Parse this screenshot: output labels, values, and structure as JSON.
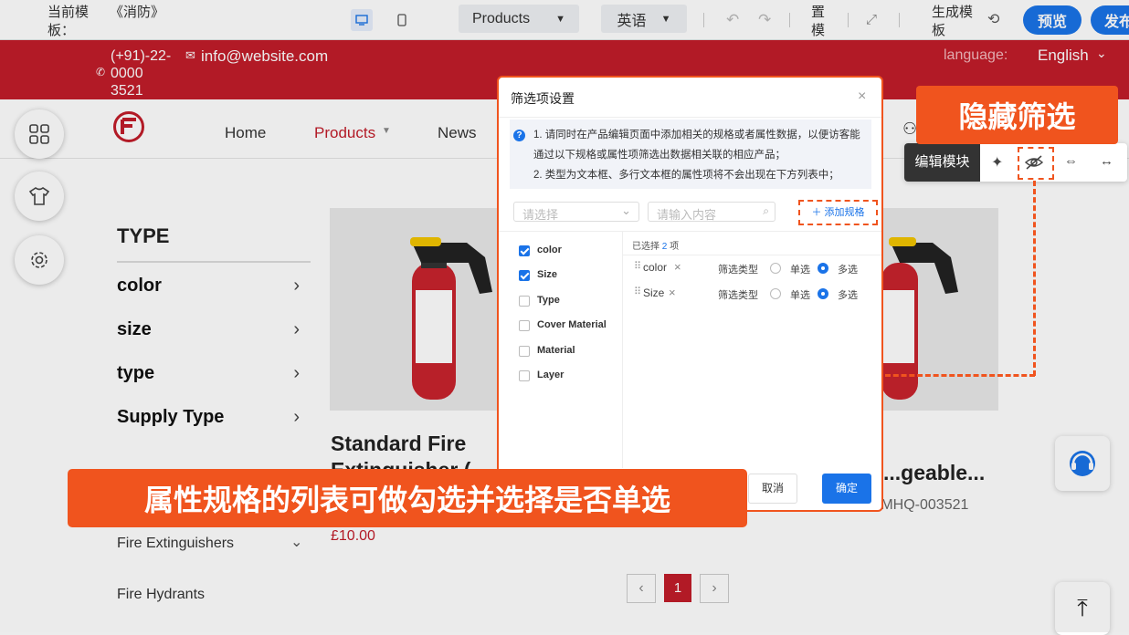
{
  "toolbar": {
    "template_label": "当前模板：",
    "template_name": "《消防》",
    "page_select": "Products",
    "lang_select": "英语",
    "settings_label": "置模",
    "generate_label": "生成模板",
    "preview": "预览",
    "publish": "发布"
  },
  "topbar": {
    "phone": "(+91)-22-0000 3521",
    "email": "info@website.com",
    "language_label": "language:",
    "language_value": "English"
  },
  "nav": {
    "items": [
      "Home",
      "Products",
      "News"
    ]
  },
  "filters": {
    "heading": "TYPE",
    "items": [
      "color",
      "size",
      "type",
      "Supply Type"
    ]
  },
  "categories": [
    "Fire Extinguishers",
    "Fire Hydrants"
  ],
  "products": [
    {
      "title": "Standard Fire Extinguisher (",
      "price": "£10.00"
    },
    {
      "title": "...geable...",
      "model": "...MHQ-003521"
    }
  ],
  "pagination": {
    "current": "1"
  },
  "module_bar": {
    "label": "编辑模块"
  },
  "annotations": {
    "hide_filter": "隐藏筛选",
    "bottom_banner": "属性规格的列表可做勾选并选择是否单选"
  },
  "dialog": {
    "title": "筛选项设置",
    "note_1": "1. 请同时在产品编辑页面中添加相关的规格或者属性数据，以便访客能通过以下规格或属性项筛选出数据相关联的相应产品；",
    "note_2": "2. 类型为文本框、多行文本框的属性项将不会出现在下方列表中；",
    "select_placeholder": "请选择",
    "input_placeholder": "请输入内容",
    "add_spec": "添加规格",
    "options": [
      {
        "label": "color",
        "checked": true
      },
      {
        "label": "Size",
        "checked": true
      },
      {
        "label": "Type",
        "checked": false
      },
      {
        "label": "Cover Material",
        "checked": false
      },
      {
        "label": "Material",
        "checked": false
      },
      {
        "label": "Layer",
        "checked": false
      }
    ],
    "selected_prefix": "已选择",
    "selected_count": "2",
    "selected_suffix": "项",
    "selected": [
      {
        "name": "color",
        "filter_type_label": "筛选类型",
        "single": "单选",
        "multi": "多选"
      },
      {
        "name": "Size",
        "filter_type_label": "筛选类型",
        "single": "单选",
        "multi": "多选"
      }
    ],
    "cancel": "取消",
    "confirm": "确定"
  },
  "colors": {
    "brand_red": "#c21d2a",
    "accent_orange": "#f0541e",
    "primary_blue": "#1a73e8"
  }
}
